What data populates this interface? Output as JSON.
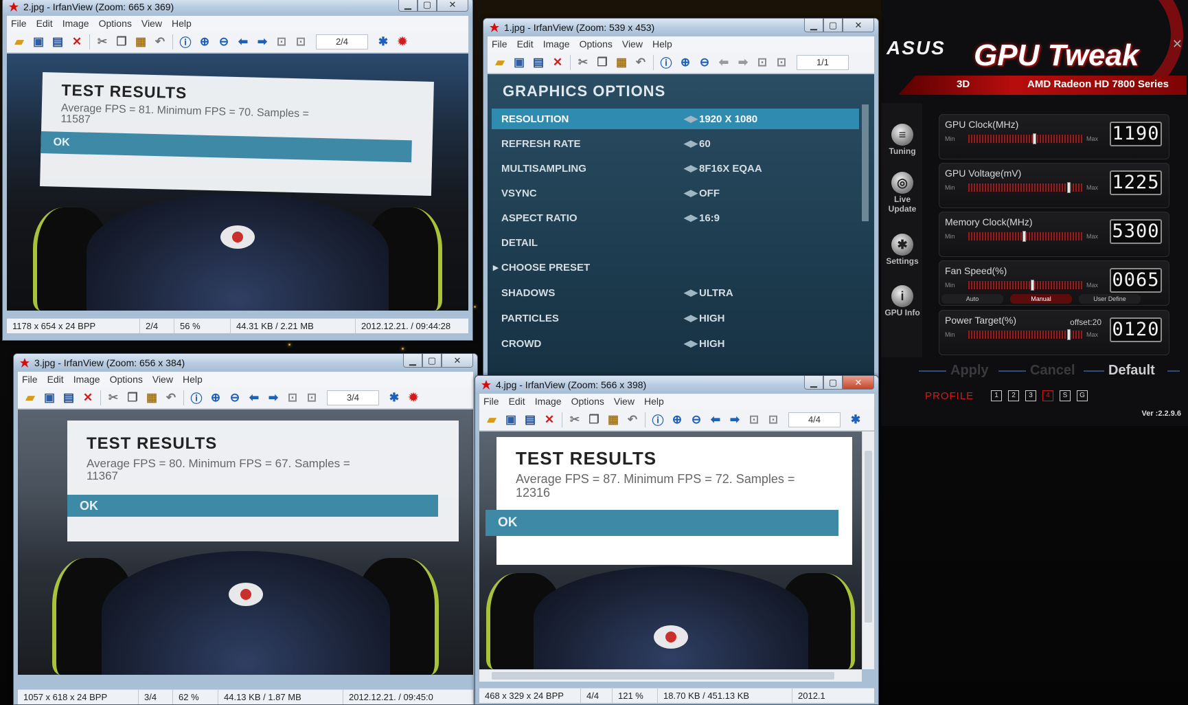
{
  "colors": {
    "accent_red": "#d11b1b",
    "ok_bar": "#3e8aa6",
    "menu_selected": "#2f8bb0"
  },
  "menu": [
    "File",
    "Edit",
    "Image",
    "Options",
    "View",
    "Help"
  ],
  "windows": {
    "w2": {
      "title": "2.jpg - IrfanView (Zoom: 665 x 369)",
      "page_index": "2/4",
      "results": {
        "title": "TEST RESULTS",
        "line1": "Average FPS = 81. Minimum FPS = 70. Samples =",
        "line2": "11587",
        "ok": "OK"
      },
      "status": [
        "1178 x 654 x 24 BPP",
        "2/4",
        "56 %",
        "44.31 KB / 2.21 MB",
        "2012.12.21. / 09:44:28"
      ]
    },
    "w1": {
      "title": "1.jpg - IrfanView (Zoom: 539 x 453)",
      "page_index": "1/1",
      "graphics": {
        "heading": "GRAPHICS OPTIONS",
        "rows": [
          {
            "label": "RESOLUTION",
            "value": "1920 X 1080"
          },
          {
            "label": "REFRESH RATE",
            "value": "60"
          },
          {
            "label": "MULTISAMPLING",
            "value": "8F16X EQAA"
          },
          {
            "label": "VSYNC",
            "value": "OFF"
          },
          {
            "label": "ASPECT RATIO",
            "value": "16:9"
          },
          {
            "label": "DETAIL",
            "value": ""
          },
          {
            "label": "CHOOSE PRESET",
            "value": ""
          },
          {
            "label": "SHADOWS",
            "value": "ULTRA"
          },
          {
            "label": "PARTICLES",
            "value": "HIGH"
          },
          {
            "label": "CROWD",
            "value": "HIGH"
          }
        ]
      }
    },
    "w3": {
      "title": "3.jpg - IrfanView (Zoom: 656 x 384)",
      "page_index": "3/4",
      "results": {
        "title": "TEST RESULTS",
        "line1": "Average FPS = 80. Minimum FPS = 67. Samples =",
        "line2": "11367",
        "ok": "OK"
      },
      "status": [
        "1057 x 618 x 24 BPP",
        "3/4",
        "62 %",
        "44.13 KB / 1.87 MB",
        "2012.12.21. / 09:45:0"
      ]
    },
    "w4": {
      "title": "4.jpg - IrfanView (Zoom: 566 x 398)",
      "page_index": "4/4",
      "results": {
        "title": "TEST RESULTS",
        "line1": "Average FPS = 87. Minimum FPS = 72. Samples =",
        "line2": "12316",
        "ok": "OK"
      },
      "status": [
        "468 x 329 x 24 BPP",
        "4/4",
        "121 %",
        "18.70 KB / 451.13 KB",
        "2012.1"
      ]
    }
  },
  "gpu_tweak": {
    "brand": "ASUS",
    "title": "GPU Tweak",
    "mode": "3D",
    "card": "AMD Radeon HD 7800 Series",
    "sidebar": [
      "Tuning",
      "Live Update",
      "Settings",
      "GPU Info"
    ],
    "panels": [
      {
        "label": "GPU Clock(MHz)",
        "value": "1190",
        "min": "Min",
        "max": "Max",
        "level": 0.58
      },
      {
        "label": "GPU Voltage(mV)",
        "value": "1225",
        "min": "Min",
        "max": "Max",
        "level": 0.88
      },
      {
        "label": "Memory Clock(MHz)",
        "value": "5300",
        "min": "Min",
        "max": "Max",
        "level": 0.49
      },
      {
        "label": "Fan Speed(%)",
        "value": "0065",
        "min": "Min",
        "max": "Max",
        "level": 0.56
      },
      {
        "label": "Power Target(%)",
        "value": "0120",
        "min": "Min",
        "max": "Max",
        "level": 0.88,
        "offset": "offset:20"
      }
    ],
    "fan_modes": [
      "Auto",
      "Manual",
      "User Define"
    ],
    "actions": [
      "Apply",
      "Cancel",
      "Default"
    ],
    "profile_label": "PROFILE",
    "profiles": [
      "1",
      "2",
      "3",
      "4",
      "S",
      "G"
    ],
    "version": "Ver :2.2.9.6"
  }
}
